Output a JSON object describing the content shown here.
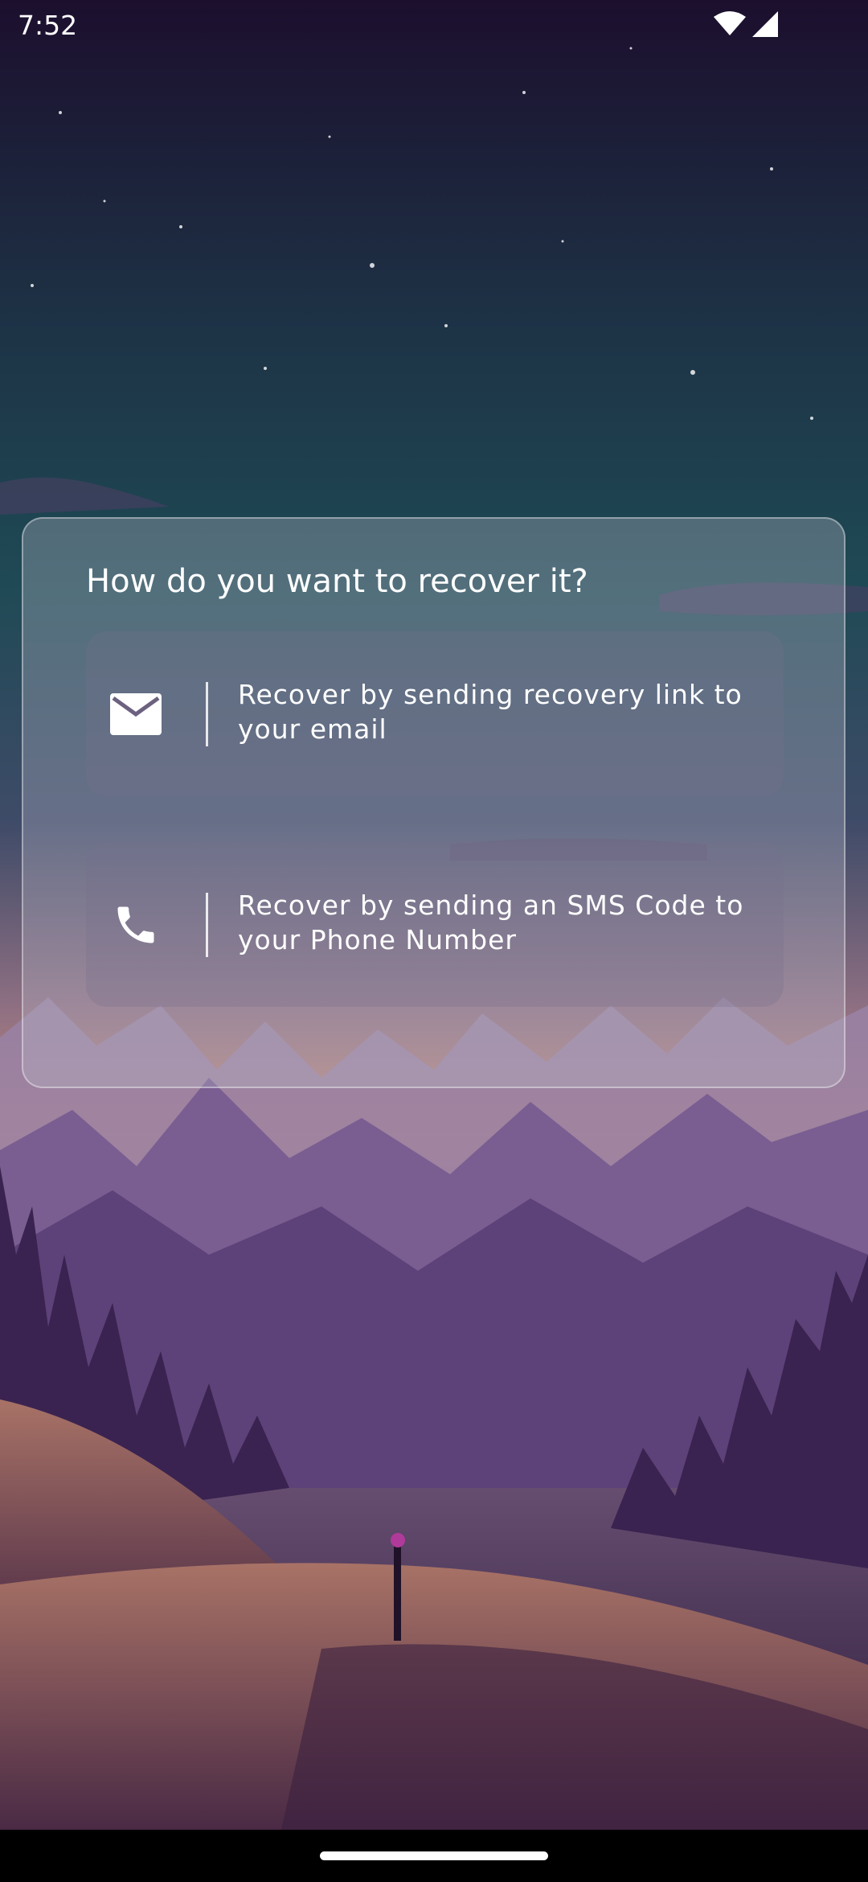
{
  "status_bar": {
    "time": "7:52",
    "icons": [
      "wifi-icon",
      "signal-icon"
    ]
  },
  "recovery_dialog": {
    "title": "How do you want to recover it?",
    "options": [
      {
        "icon": "mail-icon",
        "label": "Recover by sending recovery link to your email"
      },
      {
        "icon": "phone-icon",
        "label": "Recover by sending an SMS Code to your Phone Number"
      }
    ]
  },
  "colors": {
    "text": "#ffffff",
    "sky_top": "#1c0f2e",
    "sky_mid": "#1f4a55",
    "horizon": "#c58a78",
    "mountains": "#6e4f88",
    "foreground": "#2e1a3c"
  },
  "nav_bar": {
    "home_indicator": "home-indicator"
  }
}
